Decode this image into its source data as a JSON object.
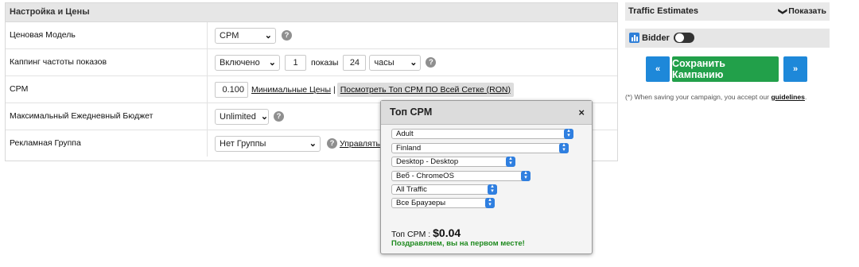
{
  "settings": {
    "title": "Настройка и Цены",
    "rows": [
      {
        "label": "Ценовая Модель"
      },
      {
        "label": "Каппинг частоты показов"
      },
      {
        "label": "CPM"
      },
      {
        "label": "Максимальный Ежедневный Бюджет"
      },
      {
        "label": "Рекламная Группа"
      }
    ],
    "pricing_model": {
      "value": "CPM"
    },
    "capping": {
      "mode": "Включено",
      "impressions": "1",
      "impressions_label": "показы",
      "hours": "24",
      "period": "часы"
    },
    "cpm": {
      "value": "0.100",
      "min_prices_link": "Минимальные Цены",
      "separator": "|",
      "top_cpm_link": "Посмотреть Топ CPM ПО Всей Сетке (RON)"
    },
    "daily_budget": {
      "value": "Unlimited"
    },
    "ad_group": {
      "value": "Нет Группы",
      "manage_link": "Управлять Гр"
    }
  },
  "traffic_estimates": {
    "title": "Traffic Estimates",
    "toggle_label": "Показать"
  },
  "bidder": {
    "label": "Bidder",
    "enabled": false
  },
  "buttons": {
    "prev": "«",
    "save": "Сохранить Кампанию",
    "next": "»"
  },
  "save_note": {
    "text": "(*) When saving your campaign, you accept our ",
    "link": "guidelines",
    "end": "."
  },
  "top_cpm_popup": {
    "title": "Топ CPM",
    "close": "×",
    "filters": [
      "Adult",
      "Finland",
      "Desktop - Desktop",
      "Веб - ChromeOS",
      "All Traffic",
      "Все Браузеры"
    ],
    "cpm_label": "Топ CPM : ",
    "cpm_value": "$0.04",
    "message": "Поздравляем, вы на первом месте!"
  },
  "colors": {
    "save": "#22a04a",
    "nav": "#1e88d9",
    "congrats": "#1f8a1f",
    "select_arrow": "#2f7fe0"
  }
}
